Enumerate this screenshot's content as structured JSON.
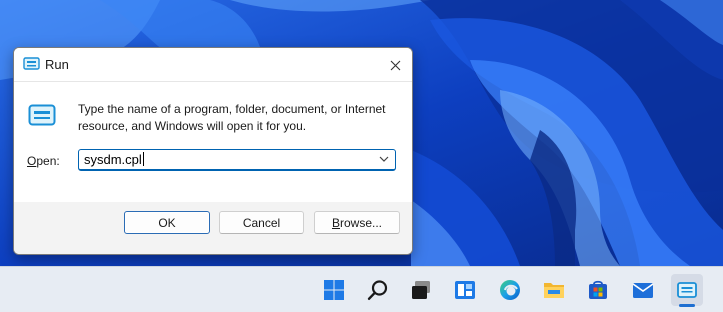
{
  "dialog": {
    "title": "Run",
    "instruction": "Type the name of a program, folder, document, or Internet resource, and Windows will open it for you.",
    "open_label_accel": "O",
    "open_label_rest": "pen:",
    "open_value": "sysdm.cpl",
    "buttons": {
      "ok": "OK",
      "cancel": "Cancel",
      "browse_accel": "B",
      "browse_rest": "rowse..."
    }
  },
  "taskbar": {
    "icons": [
      "windows-start-icon",
      "search-icon",
      "task-view-icon",
      "widgets-icon",
      "edge-browser-icon",
      "file-explorer-icon",
      "microsoft-store-icon",
      "mail-icon",
      "run-app-icon"
    ],
    "active": "run-app-icon"
  },
  "colors": {
    "accent": "#0063b1",
    "wallpaper_base": "#0b3fb8",
    "taskbar_bg": "#e7ecf3",
    "footer_bg": "#f3f3f3"
  }
}
